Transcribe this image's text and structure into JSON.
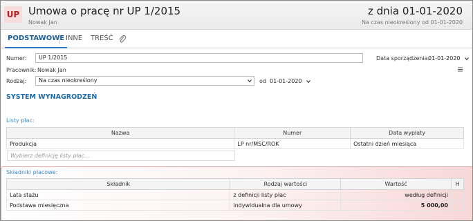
{
  "header": {
    "badge": "UP",
    "title": "Umowa o pracę nr UP 1/2015",
    "subtitle": "Nowak Jan",
    "date_title": "z dnia 01-01-2020",
    "date_subtitle": "Na czas nieokreślony od 01-01-2020"
  },
  "tabs": [
    {
      "label": "PODSTAWOWE",
      "active": true
    },
    {
      "label": "INNE",
      "active": false
    },
    {
      "label": "TREŚĆ",
      "active": false
    }
  ],
  "form": {
    "numer_label": "Numer:",
    "numer_value": "UP 1/2015",
    "data_sporz_label": "Data sporządzenia:",
    "data_sporz_value": "01-01-2020",
    "pracownik_label": "Pracownik:",
    "pracownik_value": "Nowak Jan",
    "rodzaj_label": "Rodzaj:",
    "rodzaj_value": "Na czas nieokreślony",
    "od_label": "od",
    "od_value": "01-01-2020"
  },
  "section_title": "SYSTEM WYNAGRODZEŃ",
  "listy_plac": {
    "title": "Listy płac:",
    "columns": [
      "Nazwa",
      "Numer",
      "Data wypłaty"
    ],
    "rows": [
      [
        "Produkcja",
        "LP nr/MSC/ROK",
        "Ostatni dzień miesiąca"
      ]
    ],
    "placeholder": "Wybierz definicję listy płac..."
  },
  "skladniki": {
    "title": "Składniki płacowe:",
    "columns": [
      "Składnik",
      "Rodzaj wartości",
      "Wartość",
      "H"
    ],
    "rows": [
      [
        "Lata stażu",
        "z definicji listy płac",
        "według definicji",
        ""
      ],
      [
        "Podstawa miesięczna",
        "indywidualna dla umowy",
        "5 000,00",
        ""
      ]
    ]
  },
  "colors": {
    "badge_bg": "#f7dcdc",
    "badge_text": "#b42020",
    "accent": "#1d6aa8",
    "highlight": "#f6cdcd"
  }
}
